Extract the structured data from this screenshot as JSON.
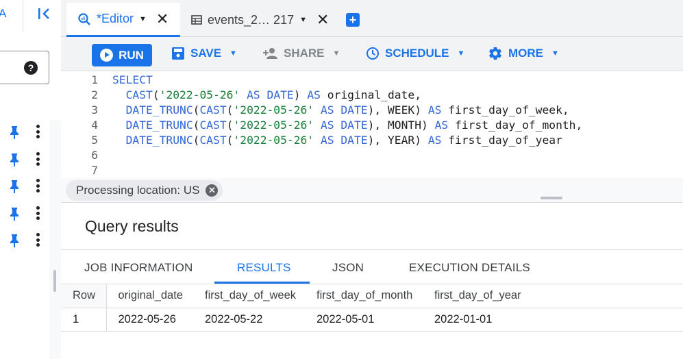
{
  "left_rail": {
    "top_letter": "A",
    "help_glyph": "?",
    "rows": [
      {
        "pin_icon": "pin-icon",
        "menu_icon": "more-vert-icon"
      },
      {
        "pin_icon": "pin-icon",
        "menu_icon": "more-vert-icon"
      },
      {
        "pin_icon": "pin-icon",
        "menu_icon": "more-vert-icon"
      },
      {
        "pin_icon": "pin-icon",
        "menu_icon": "more-vert-icon"
      },
      {
        "pin_icon": "pin-icon",
        "menu_icon": "more-vert-icon"
      }
    ]
  },
  "tabs": [
    {
      "label": "*Editor",
      "icon": "query-icon",
      "active": true
    },
    {
      "label": "events_2… 217",
      "icon": "table-icon",
      "active": false
    }
  ],
  "toolbar": {
    "run": "RUN",
    "save": "SAVE",
    "share": "SHARE",
    "schedule": "SCHEDULE",
    "more": "MORE"
  },
  "editor": {
    "line_numbers": [
      "1",
      "2",
      "3",
      "4",
      "5",
      "6",
      "7"
    ],
    "lines": [
      "SELECT",
      "  CAST('2022-05-26' AS DATE) AS original_date,",
      "  DATE_TRUNC(CAST('2022-05-26' AS DATE), WEEK) AS first_day_of_week,",
      "  DATE_TRUNC(CAST('2022-05-26' AS DATE), MONTH) AS first_day_of_month,",
      "  DATE_TRUNC(CAST('2022-05-26' AS DATE), YEAR) AS first_day_of_year",
      "",
      ""
    ]
  },
  "processing_location": "Processing location: US",
  "results": {
    "title": "Query results",
    "tabs": [
      "JOB INFORMATION",
      "RESULTS",
      "JSON",
      "EXECUTION DETAILS"
    ],
    "active_tab": "RESULTS",
    "columns": [
      "Row",
      "original_date",
      "first_day_of_week",
      "first_day_of_month",
      "first_day_of_year"
    ],
    "rows": [
      [
        "1",
        "2022-05-26",
        "2022-05-22",
        "2022-05-01",
        "2022-01-01"
      ]
    ]
  },
  "colors": {
    "accent": "#1a73e8",
    "keyword": "#3367d6",
    "string": "#188038"
  }
}
